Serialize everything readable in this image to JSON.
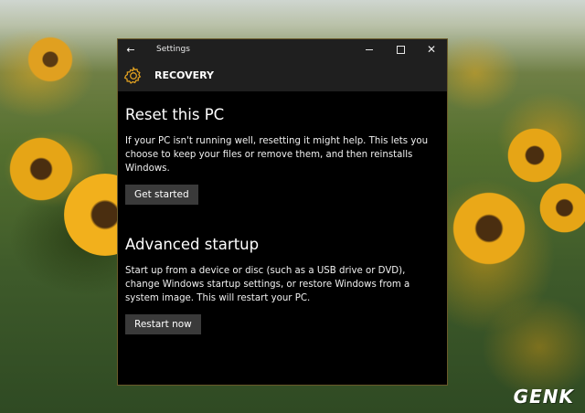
{
  "window": {
    "title": "Settings",
    "back_icon": "arrow-left-icon",
    "controls": {
      "minimize_icon": "minimize-icon",
      "maximize_icon": "maximize-icon",
      "close_icon": "close-icon"
    }
  },
  "header": {
    "icon": "gear-icon",
    "icon_color": "#e0a020",
    "title": "RECOVERY"
  },
  "reset_section": {
    "title": "Reset this PC",
    "description": "If your PC isn't running well, resetting it might help. This lets you choose to keep your files or remove them, and then reinstalls Windows.",
    "button_label": "Get started"
  },
  "advanced_section": {
    "title": "Advanced startup",
    "description": "Start up from a device or disc (such as a USB drive or DVD), change Windows startup settings, or restore Windows from a system image. This will restart your PC.",
    "button_label": "Restart now"
  },
  "watermark": {
    "text": "GENK"
  }
}
